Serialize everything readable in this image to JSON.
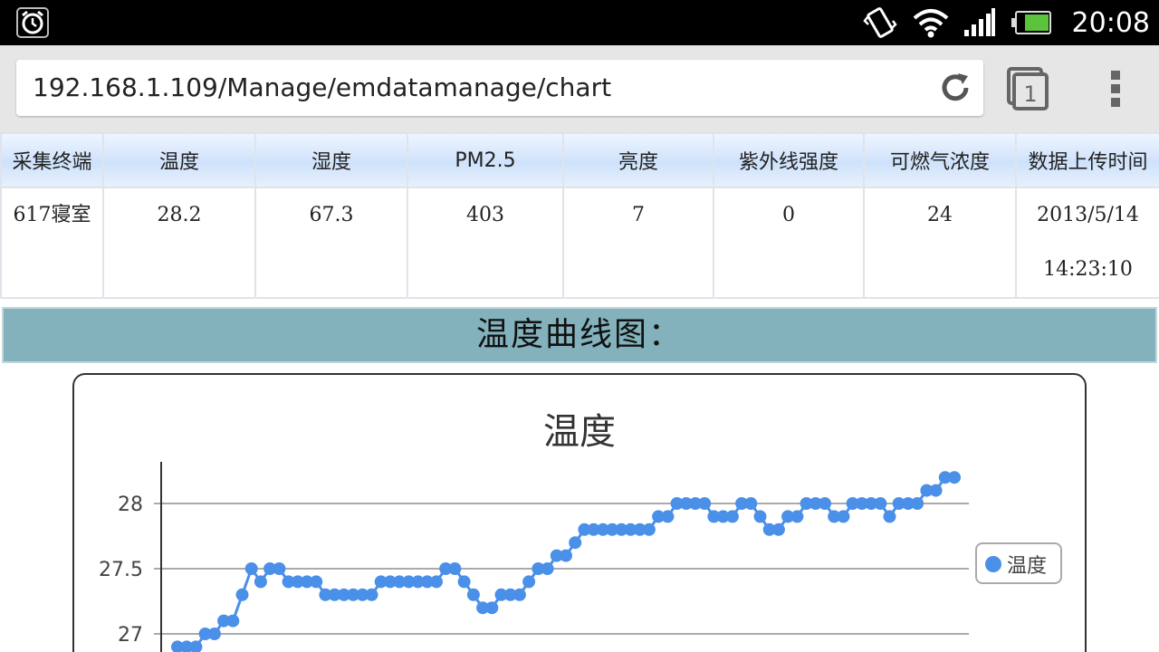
{
  "status": {
    "time": "20:08",
    "icons": [
      "alarm-icon",
      "vibrate-icon",
      "wifi-icon",
      "signal-icon",
      "battery-icon"
    ]
  },
  "browser": {
    "url": "192.168.1.109/Manage/emdatamanage/chart",
    "icons": [
      "reload-icon",
      "tabs-icon",
      "overflow-menu-icon"
    ],
    "tab_count": "1"
  },
  "table": {
    "headers": [
      "采集终端",
      "温度",
      "湿度",
      "PM2.5",
      "亮度",
      "紫外线强度",
      "可燃气浓度",
      "数据上传时间"
    ],
    "row": {
      "terminal": "617寝室",
      "temperature": "28.2",
      "humidity": "67.3",
      "pm25": "403",
      "brightness": "7",
      "uv": "0",
      "gas": "24",
      "upload_date": "2013/5/14",
      "upload_time": "14:23:10"
    }
  },
  "section": {
    "title": "温度曲线图："
  },
  "chart_data": {
    "type": "line",
    "title": "温度",
    "xlabel": "",
    "ylabel": "",
    "yticks": [
      "28",
      "27.5",
      "27"
    ],
    "ylim": [
      26.6,
      28.3
    ],
    "grid": true,
    "legend_position": "right",
    "series": [
      {
        "name": "温度",
        "color": "#4a8fe8",
        "values": [
          26.9,
          26.9,
          26.9,
          27.0,
          27.0,
          27.1,
          27.1,
          27.3,
          27.5,
          27.4,
          27.5,
          27.5,
          27.4,
          27.4,
          27.4,
          27.4,
          27.3,
          27.3,
          27.3,
          27.3,
          27.3,
          27.3,
          27.4,
          27.4,
          27.4,
          27.4,
          27.4,
          27.4,
          27.4,
          27.5,
          27.5,
          27.4,
          27.3,
          27.2,
          27.2,
          27.3,
          27.3,
          27.3,
          27.4,
          27.5,
          27.5,
          27.6,
          27.6,
          27.7,
          27.8,
          27.8,
          27.8,
          27.8,
          27.8,
          27.8,
          27.8,
          27.8,
          27.9,
          27.9,
          28.0,
          28.0,
          28.0,
          28.0,
          27.9,
          27.9,
          27.9,
          28.0,
          28.0,
          27.9,
          27.8,
          27.8,
          27.9,
          27.9,
          28.0,
          28.0,
          28.0,
          27.9,
          27.9,
          28.0,
          28.0,
          28.0,
          28.0,
          27.9,
          28.0,
          28.0,
          28.0,
          28.1,
          28.1,
          28.2,
          28.2
        ]
      }
    ]
  }
}
